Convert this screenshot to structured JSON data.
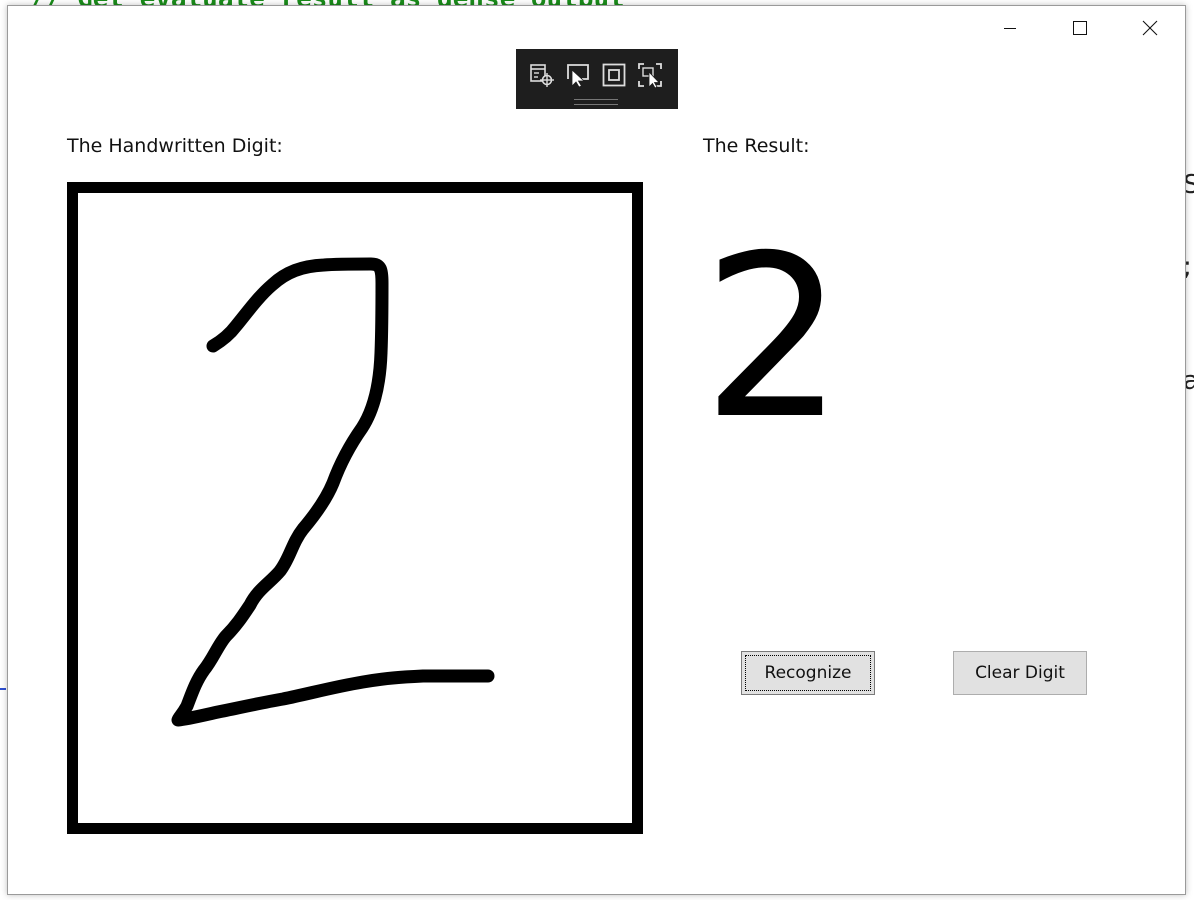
{
  "background": {
    "code_top": "// Get evaluate result as dense output",
    "right_chars": [
      "S",
      ";",
      "a"
    ]
  },
  "window": {
    "controls": {
      "minimize_icon": "minimize-icon",
      "maximize_icon": "maximize-icon",
      "close_icon": "close-icon"
    },
    "debug_toolbar": {
      "icons": [
        "live-visual-tree-icon",
        "select-element-icon",
        "display-layout-adorners-icon",
        "track-focused-element-icon"
      ]
    },
    "input_label": "The Handwritten Digit:",
    "result_label": "The Result:",
    "result_value": "2",
    "buttons": {
      "recognize": "Recognize",
      "clear": "Clear Digit"
    }
  }
}
